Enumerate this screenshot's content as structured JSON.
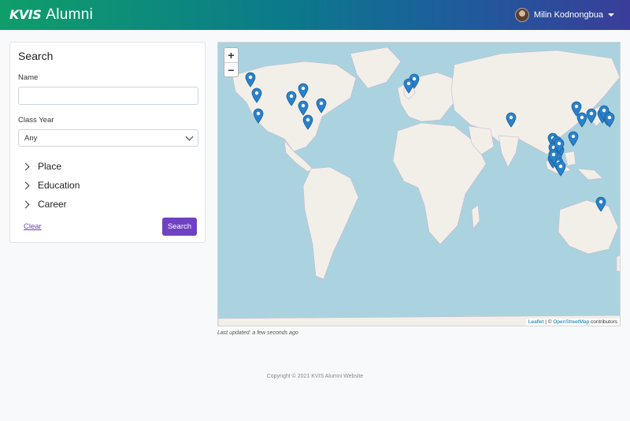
{
  "navbar": {
    "brand_logo": "KVIS",
    "brand_name": "Alumni",
    "user_name": "Milin Kodnongbua"
  },
  "search": {
    "title": "Search",
    "name_label": "Name",
    "name_value": "",
    "class_year_label": "Class Year",
    "class_year_value": "Any",
    "sections": [
      "Place",
      "Education",
      "Career"
    ],
    "clear_label": "Clear",
    "search_label": "Search"
  },
  "map": {
    "zoom_in": "+",
    "zoom_out": "−",
    "attribution_leaflet": "Leaflet",
    "attribution_sep": " | © ",
    "attribution_osm": "OpenStreetMap",
    "attribution_tail": " contributors",
    "marker_color": "#2a81cb",
    "marker_count": 30
  },
  "last_updated": "Last updated: a few seconds ago",
  "footer": "Copyright © 2021 KVIS Alumni Website"
}
